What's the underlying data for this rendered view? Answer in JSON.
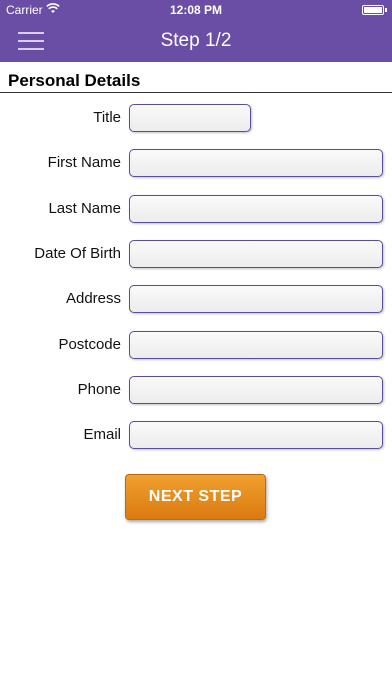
{
  "status_bar": {
    "carrier": "Carrier",
    "time": "12:08 PM"
  },
  "nav": {
    "title": "Step 1/2",
    "menu_icon": "hamburger-menu-icon"
  },
  "section": {
    "title": "Personal Details"
  },
  "form": {
    "fields": [
      {
        "label": "Title",
        "value": ""
      },
      {
        "label": "First Name",
        "value": ""
      },
      {
        "label": "Last Name",
        "value": ""
      },
      {
        "label": "Date Of Birth",
        "value": ""
      },
      {
        "label": "Address",
        "value": ""
      },
      {
        "label": "Postcode",
        "value": ""
      },
      {
        "label": "Phone",
        "value": ""
      },
      {
        "label": "Email",
        "value": ""
      }
    ]
  },
  "actions": {
    "next_label": "NEXT STEP"
  },
  "colors": {
    "bar_background": "#6a4ea5",
    "button_orange": "#e8901f",
    "input_border": "#5c4d9a"
  }
}
